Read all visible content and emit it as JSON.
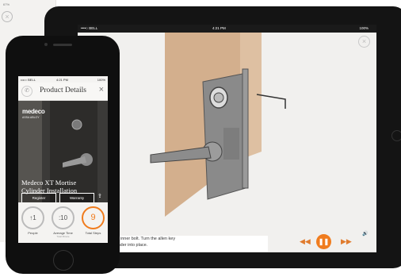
{
  "background_screen": {
    "status_battery": "67%",
    "close_icon": "×"
  },
  "ipad": {
    "status": {
      "carrier": "••••○ BELL",
      "time": "4:21 PM",
      "battery": "100%"
    },
    "close_icon": "×",
    "instruction_line1": "the allen key into the inner bolt. Turn the allen key",
    "instruction_line2": "se to tighten the cylinder into place.",
    "controls": {
      "prev": "◀◀",
      "play": "❚❚",
      "next": "▶▶",
      "volume": "🔊"
    }
  },
  "iphone": {
    "status": {
      "carrier": "••••○ BELL",
      "time": "4:21 PM",
      "battery": "100%"
    },
    "header": {
      "title": "Product Details",
      "back_icon": "phone-icon",
      "close_icon": "×"
    },
    "hero": {
      "logo": "medeco",
      "logo_sub": "ASSA ABLOY",
      "title": "Medeco XT Mortise Cylinder Installation",
      "register_label": "Register",
      "warranty_label": "Warranty"
    },
    "stats": [
      {
        "value": "↑1",
        "label": "People",
        "note": ""
      },
      {
        "value": ":10",
        "label": "Average Time",
        "note": "Total   Minute"
      },
      {
        "value": "9",
        "label": "Total Steps",
        "note": ""
      }
    ]
  },
  "colors": {
    "accent": "#f07c1e",
    "door": "#c89a6c",
    "device": "#141414"
  }
}
